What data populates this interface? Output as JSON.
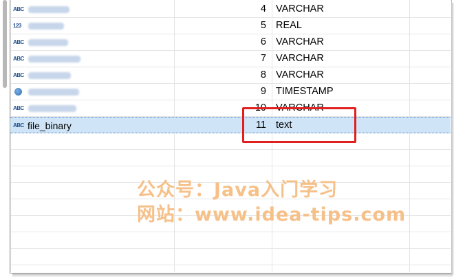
{
  "columns_table": {
    "rows": [
      {
        "name": "file_type",
        "position": "4",
        "datatype": "VARCHAR",
        "type_icon": "ABC",
        "icon": "text-type-icon",
        "blurred": true
      },
      {
        "name": "file_size",
        "position": "5",
        "datatype": "REAL",
        "type_icon": "123",
        "icon": "numeric-type-icon",
        "blurred": true
      },
      {
        "name": "file_desc",
        "position": "6",
        "datatype": "VARCHAR",
        "type_icon": "ABC",
        "icon": "text-type-icon",
        "blurred": true
      },
      {
        "name": "file_source",
        "position": "7",
        "datatype": "VARCHAR",
        "type_icon": "ABC",
        "icon": "text-type-icon",
        "blurred": true
      },
      {
        "name": "file_state",
        "position": "8",
        "datatype": "VARCHAR",
        "type_icon": "ABC",
        "icon": "text-type-icon",
        "blurred": true
      },
      {
        "name": "create_time",
        "position": "9",
        "datatype": "TIMESTAMP",
        "type_icon": "",
        "icon": "clock-type-icon",
        "blurred": true
      },
      {
        "name": "create_user",
        "position": "10",
        "datatype": "VARCHAR",
        "type_icon": "ABC",
        "icon": "text-type-icon",
        "blurred": true
      },
      {
        "name": "file_binary",
        "position": "11",
        "datatype": "text",
        "type_icon": "ABC",
        "icon": "text-type-icon",
        "blurred": false,
        "selected": true
      }
    ]
  },
  "watermark": {
    "line1": "公众号：Java入门学习",
    "line2": "网站：www.idea-tips.com"
  },
  "colors": {
    "selection": "#cfe4f6",
    "highlight_border": "#e0201e",
    "watermark": "#f6c089"
  }
}
